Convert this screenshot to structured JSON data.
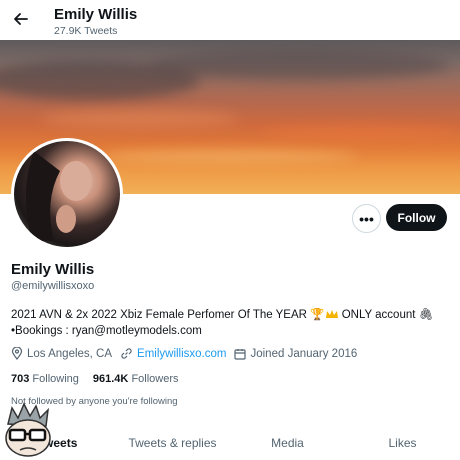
{
  "header": {
    "name": "Emily Willis",
    "tweet_count": "27.9K Tweets"
  },
  "profile": {
    "name": "Emily Willis",
    "handle": "@emilywillisxoxo",
    "bio_line1": "2021 AVN & 2x 2022 Xbiz Female Perfomer Of The YEAR",
    "bio_line1_suffix": "ONLY account",
    "bio_line2": "•Bookings : ryan@motleymodels.com",
    "location": "Los Angeles, CA",
    "website": "Emilywillisxo.com",
    "joined": "Joined January 2016",
    "following_count": "703",
    "following_label": "Following",
    "followers_count": "961.4K",
    "followers_label": "Followers",
    "not_followed": "Not followed by anyone you're following"
  },
  "buttons": {
    "more": "•••",
    "follow": "Follow"
  },
  "tabs": [
    {
      "label": "Tweets"
    },
    {
      "label": "Tweets & replies"
    },
    {
      "label": "Media"
    },
    {
      "label": "Likes"
    }
  ],
  "icons": {
    "back": "back-arrow-icon",
    "location": "location-pin-icon",
    "link": "link-icon",
    "calendar": "calendar-icon"
  },
  "colors": {
    "accent": "#1d9bf0",
    "follow_bg": "#0f1419",
    "secondary_text": "#536471"
  }
}
